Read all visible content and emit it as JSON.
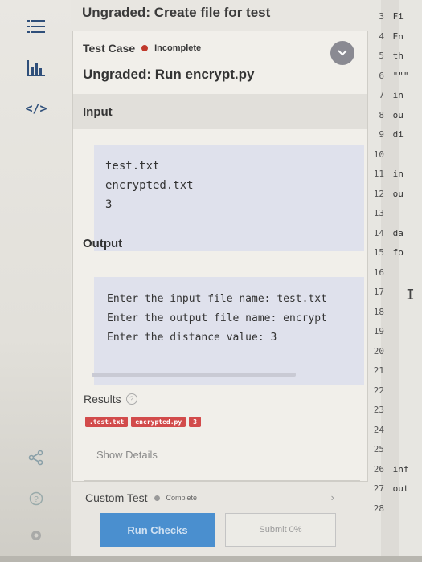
{
  "header": {
    "title": "Ungraded: Create file for test"
  },
  "rail": {
    "icons": [
      "list-icon",
      "bar-chart-icon",
      "code-icon",
      "share-icon",
      "help-icon",
      "settings-icon"
    ],
    "code_glyph": "</>"
  },
  "test_case": {
    "label": "Test Case",
    "status": "Incomplete",
    "status_color": "#c0392b",
    "title": "Ungraded: Run encrypt.py"
  },
  "input": {
    "heading": "Input",
    "lines": [
      "test.txt",
      "encrypted.txt",
      "3"
    ]
  },
  "output": {
    "heading": "Output",
    "lines": [
      "Enter the input file name: test.txt",
      "Enter the output file name: encrypt",
      "Enter the distance value: 3"
    ]
  },
  "results": {
    "label": "Results",
    "badges": [
      ".test.txt",
      "encrypted.py",
      "3"
    ],
    "show_details": "Show Details"
  },
  "custom_test": {
    "label": "Custom Test",
    "status": "Complete"
  },
  "buttons": {
    "run": "Run Checks",
    "submit": "Submit 0%"
  },
  "editor": {
    "lines": [
      {
        "num": "3",
        "code": "Fi"
      },
      {
        "num": "4",
        "code": "En"
      },
      {
        "num": "5",
        "code": "th"
      },
      {
        "num": "6",
        "code": "\"\"\""
      },
      {
        "num": "7",
        "code": "in"
      },
      {
        "num": "8",
        "code": "ou"
      },
      {
        "num": "9",
        "code": "di"
      },
      {
        "num": "10",
        "code": ""
      },
      {
        "num": "11",
        "code": "in"
      },
      {
        "num": "12",
        "code": "ou"
      },
      {
        "num": "13",
        "code": ""
      },
      {
        "num": "14",
        "code": "da"
      },
      {
        "num": "15",
        "code": "fo"
      },
      {
        "num": "16",
        "code": ""
      },
      {
        "num": "17",
        "code": ""
      },
      {
        "num": "18",
        "code": ""
      },
      {
        "num": "19",
        "code": ""
      },
      {
        "num": "20",
        "code": ""
      },
      {
        "num": "21",
        "code": ""
      },
      {
        "num": "22",
        "code": ""
      },
      {
        "num": "23",
        "code": ""
      },
      {
        "num": "24",
        "code": ""
      },
      {
        "num": "25",
        "code": ""
      },
      {
        "num": "26",
        "code": "inf"
      },
      {
        "num": "27",
        "code": "out"
      },
      {
        "num": "28",
        "code": ""
      }
    ]
  }
}
